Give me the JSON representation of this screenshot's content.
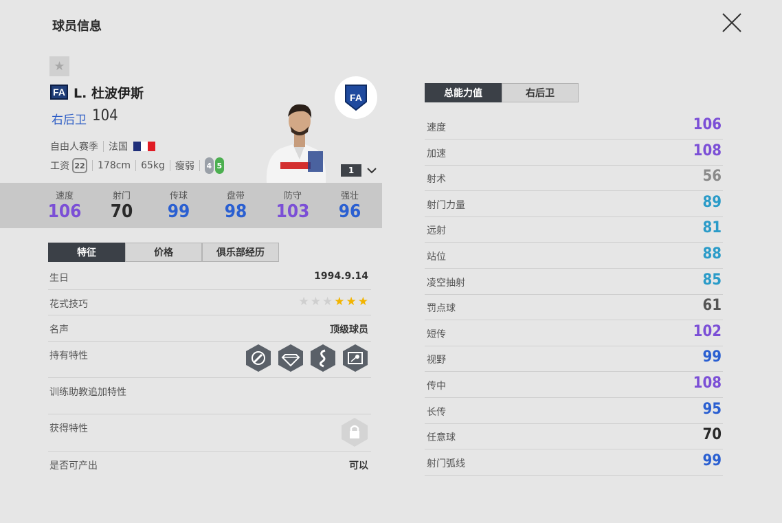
{
  "header": {
    "title": "球员信息"
  },
  "player": {
    "badge": "FA",
    "name": "L. 杜波伊斯",
    "position": "右后卫",
    "overall": "104",
    "season": "自由人赛季",
    "nation": "法国",
    "wage_label": "工资",
    "wage": "22",
    "height": "178cm",
    "weight": "65kg",
    "build": "瘦弱",
    "weak_foot": "4",
    "skill_foot": "5",
    "level": "1",
    "flag_colors": [
      "#1f2f7a",
      "#ffffff",
      "#e01b24"
    ]
  },
  "summary_stats": [
    {
      "label": "速度",
      "value": "106",
      "color": "#7b4fd6"
    },
    {
      "label": "射门",
      "value": "70",
      "color": "#2a2a2a"
    },
    {
      "label": "传球",
      "value": "99",
      "color": "#2a5fd1"
    },
    {
      "label": "盘带",
      "value": "98",
      "color": "#2a5fd1"
    },
    {
      "label": "防守",
      "value": "103",
      "color": "#7b4fd6"
    },
    {
      "label": "强壮",
      "value": "96",
      "color": "#2a5fd1"
    }
  ],
  "left_tabs": [
    "特征",
    "价格",
    "俱乐部经历"
  ],
  "info": {
    "birthday_label": "生日",
    "birthday": "1994.9.14",
    "skill_label": "花式技巧",
    "skill_stars_total": 6,
    "skill_stars_filled": 3,
    "fame_label": "名声",
    "fame": "顶级球员",
    "traits_label": "持有特性",
    "coach_traits_label": "训练助教追加特性",
    "acquired_label": "获得特性",
    "producible_label": "是否可产出",
    "producible": "可以"
  },
  "right_tabs": [
    "总能力值",
    "右后卫"
  ],
  "attributes": [
    {
      "label": "速度",
      "value": "106",
      "color": "#7b4fd6"
    },
    {
      "label": "加速",
      "value": "108",
      "color": "#7b4fd6"
    },
    {
      "label": "射术",
      "value": "56",
      "color": "#8a8a8a"
    },
    {
      "label": "射门力量",
      "value": "89",
      "color": "#2a9bc8"
    },
    {
      "label": "远射",
      "value": "81",
      "color": "#2a9bc8"
    },
    {
      "label": "站位",
      "value": "88",
      "color": "#2a9bc8"
    },
    {
      "label": "凌空抽射",
      "value": "85",
      "color": "#2a9bc8"
    },
    {
      "label": "罚点球",
      "value": "61",
      "color": "#555555"
    },
    {
      "label": "短传",
      "value": "102",
      "color": "#7b4fd6"
    },
    {
      "label": "视野",
      "value": "99",
      "color": "#2a5fd1"
    },
    {
      "label": "传中",
      "value": "108",
      "color": "#7b4fd6"
    },
    {
      "label": "长传",
      "value": "95",
      "color": "#2a5fd1"
    },
    {
      "label": "任意球",
      "value": "70",
      "color": "#2a2a2a"
    },
    {
      "label": "射门弧线",
      "value": "99",
      "color": "#2a5fd1"
    }
  ]
}
